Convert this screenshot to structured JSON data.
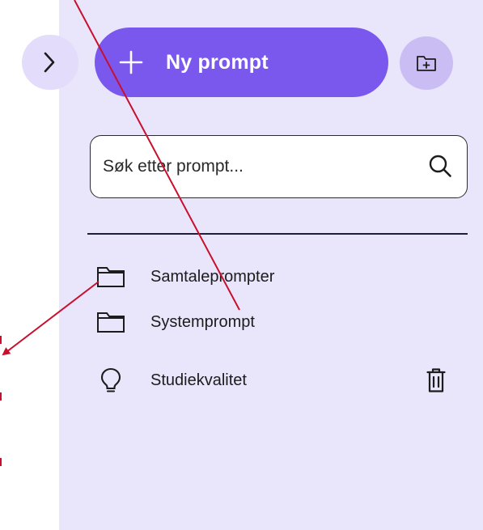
{
  "sidebar": {
    "new_prompt_label": "Ny prompt",
    "search": {
      "placeholder": "Søk etter prompt..."
    },
    "items": [
      {
        "type": "folder",
        "label": "Samtaleprompter",
        "icon": "folder-icon"
      },
      {
        "type": "folder",
        "label": "Systemprompt",
        "icon": "folder-icon"
      },
      {
        "type": "prompt",
        "label": "Studiekvalitet",
        "icon": "lightbulb-icon",
        "action_icon": "trash-icon"
      }
    ]
  },
  "colors": {
    "panel_bg": "#e9e5fb",
    "primary": "#7a58ee",
    "folder_button_bg": "#c9bdf4",
    "annotation_arrow": "#c8102e"
  },
  "icons": {
    "collapse": "chevron-right-icon",
    "new_prompt": "plus-icon",
    "new_folder": "folder-plus-icon",
    "search": "search-icon"
  }
}
